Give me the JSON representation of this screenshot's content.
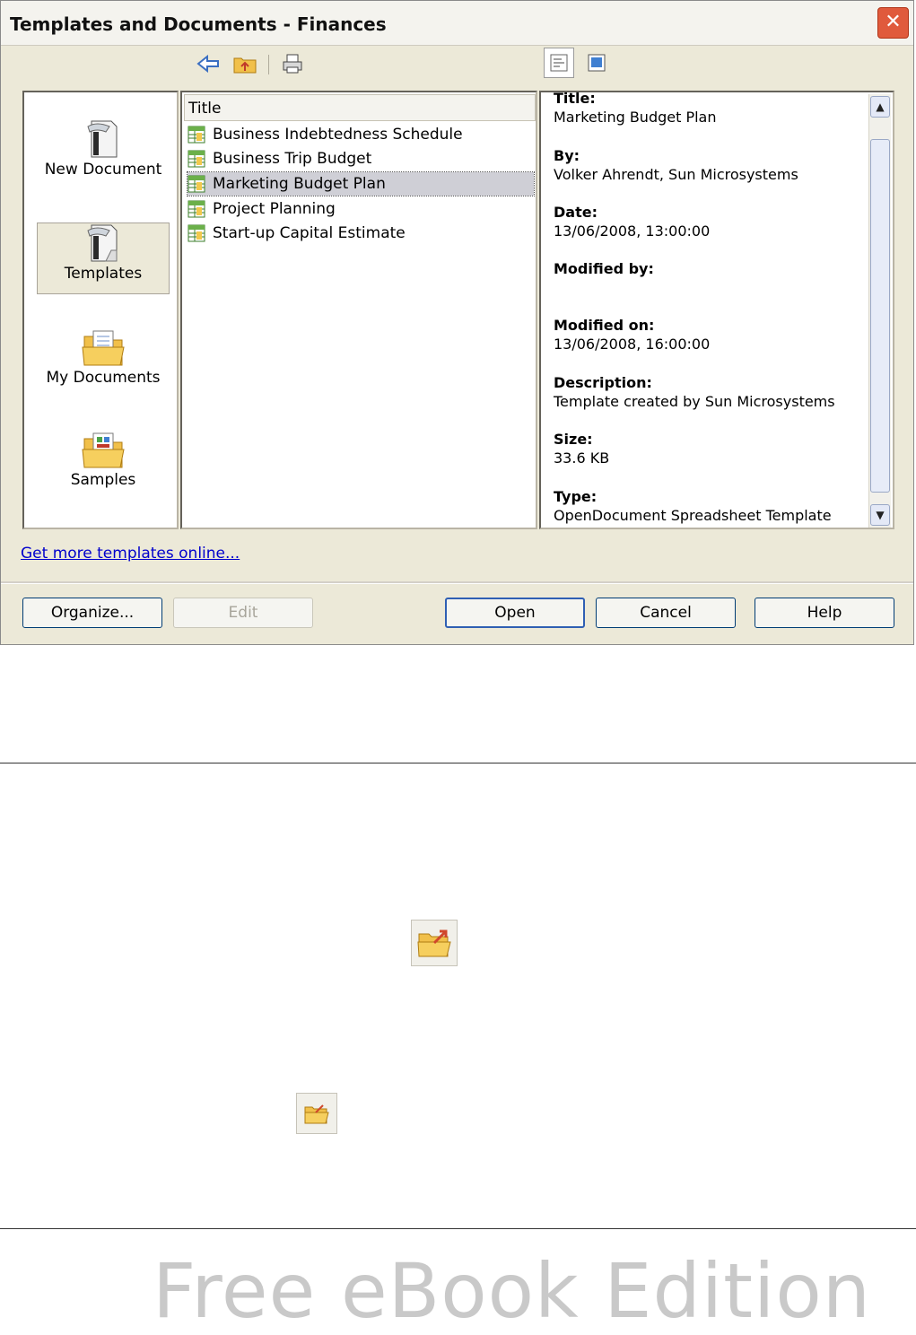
{
  "dialog": {
    "title": "Templates and Documents - Finances",
    "close_label": "✕"
  },
  "left_nav": {
    "items": [
      {
        "label": "New Document",
        "icon": "new-document-icon"
      },
      {
        "label": "Templates",
        "icon": "templates-icon",
        "active": true
      },
      {
        "label": "My Documents",
        "icon": "my-documents-icon"
      },
      {
        "label": "Samples",
        "icon": "samples-icon"
      }
    ]
  },
  "list": {
    "column_title": "Title",
    "rows": [
      {
        "title": "Business Indebtedness Schedule"
      },
      {
        "title": "Business Trip Budget"
      },
      {
        "title": "Marketing Budget Plan",
        "selected": true
      },
      {
        "title": "Project Planning"
      },
      {
        "title": "Start-up Capital Estimate"
      }
    ]
  },
  "info": {
    "title_label": "Title:",
    "title_value": "Marketing Budget Plan",
    "by_label": "By:",
    "by_value": "Volker Ahrendt, Sun Microsystems",
    "date_label": "Date:",
    "date_value": "13/06/2008, 13:00:00",
    "modified_by_label": "Modified by:",
    "modified_by_value": "",
    "modified_on_label": "Modified on:",
    "modified_on_value": "13/06/2008, 16:00:00",
    "description_label": "Description:",
    "description_value": "Template created by Sun Microsystems",
    "size_label": "Size:",
    "size_value": "33.6 KB",
    "type_label": "Type:",
    "type_value": "OpenDocument Spreadsheet Template"
  },
  "link": {
    "online_templates": "Get more templates online..."
  },
  "buttons": {
    "organize": "Organize...",
    "edit": "Edit",
    "open": "Open",
    "cancel": "Cancel",
    "help": "Help"
  },
  "watermark": "Free eBook Edition",
  "colors": {
    "link": "#0000cc",
    "default_button_border": "#2f5fb3",
    "close_button": "#e05a3c"
  }
}
